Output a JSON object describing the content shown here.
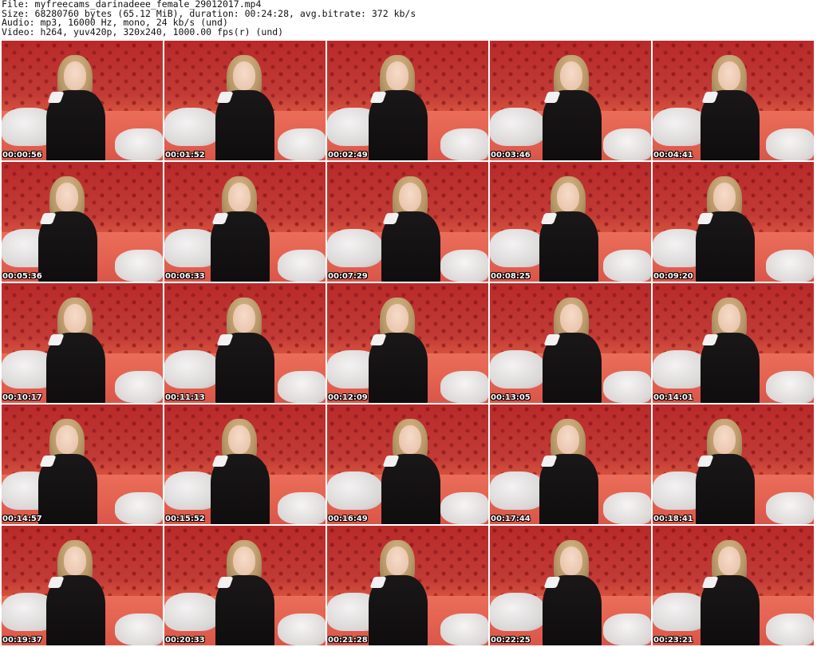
{
  "header": {
    "line1": "File: myfreecams_darinadeee_female_29012017.mp4",
    "line2": "Size: 68280760 bytes (65.12 MiB), duration: 00:24:28, avg.bitrate: 372 kb/s",
    "line3": "Audio: mp3, 16000 Hz, mono, 24 kb/s (und)",
    "line4": "Video: h264, yuv420p, 320x240, 1000.00 fps(r) (und)"
  },
  "thumbnails": [
    {
      "time": "00:00:56"
    },
    {
      "time": "00:01:52"
    },
    {
      "time": "00:02:49"
    },
    {
      "time": "00:03:46"
    },
    {
      "time": "00:04:41"
    },
    {
      "time": "00:05:36"
    },
    {
      "time": "00:06:33"
    },
    {
      "time": "00:07:29"
    },
    {
      "time": "00:08:25"
    },
    {
      "time": "00:09:20"
    },
    {
      "time": "00:10:17"
    },
    {
      "time": "00:11:13"
    },
    {
      "time": "00:12:09"
    },
    {
      "time": "00:13:05"
    },
    {
      "time": "00:14:01"
    },
    {
      "time": "00:14:57"
    },
    {
      "time": "00:15:52"
    },
    {
      "time": "00:16:49"
    },
    {
      "time": "00:17:44"
    },
    {
      "time": "00:18:41"
    },
    {
      "time": "00:19:37"
    },
    {
      "time": "00:20:33"
    },
    {
      "time": "00:21:28"
    },
    {
      "time": "00:22:25"
    },
    {
      "time": "00:23:21"
    }
  ]
}
